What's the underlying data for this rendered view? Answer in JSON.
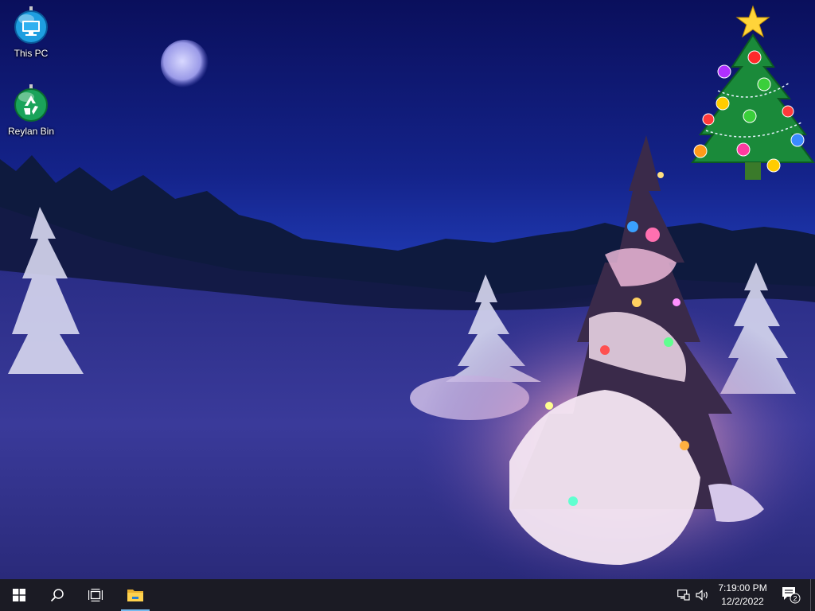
{
  "desktop": {
    "icons": [
      {
        "label": "This PC",
        "icon": "this-pc-icon"
      },
      {
        "label": "Reylan Bin",
        "icon": "recycle-bin-icon"
      }
    ],
    "gadget": {
      "icon": "christmas-tree-icon"
    }
  },
  "taskbar": {
    "start_icon": "windows-logo-icon",
    "search_icon": "search-icon",
    "task_view_icon": "task-view-icon",
    "pinned": [
      {
        "icon": "file-explorer-icon"
      }
    ],
    "tray": {
      "network_icon": "network-icon",
      "volume_icon": "volume-icon",
      "time": "7:19:00 PM",
      "date": "12/2/2022",
      "notification_count": "2"
    }
  },
  "colors": {
    "taskbar_bg": "#1b1b24",
    "sky_top": "#0a0f5c",
    "accent": "#76b9ed"
  }
}
